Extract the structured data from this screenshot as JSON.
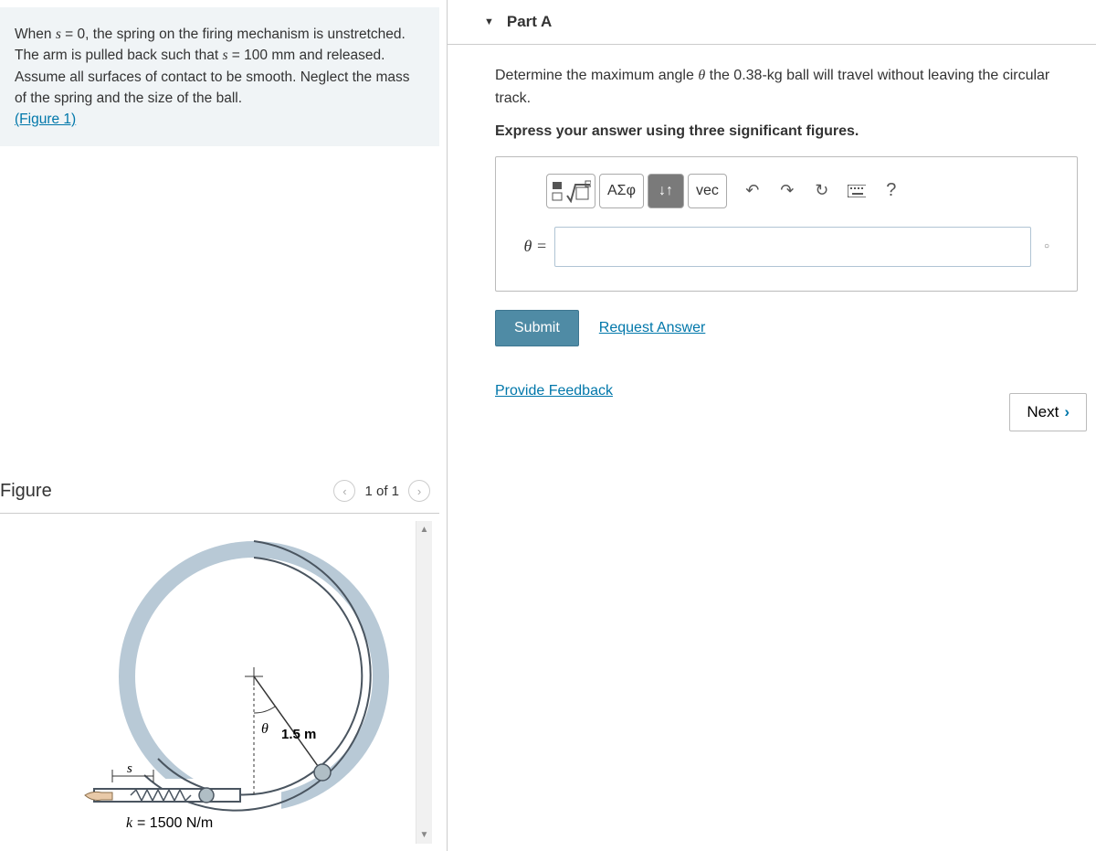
{
  "problem": {
    "text_pre": "When ",
    "var1": "s",
    "text_eq0": " = 0, the spring on the firing mechanism is unstretched. The arm is pulled back such that ",
    "var2": "s",
    "text_eq1": " = 100 ",
    "unit_mm": "mm",
    "text_post": " and released. Assume all surfaces of contact to be smooth. Neglect the mass of the spring and the size of the ball. ",
    "figure_link": "(Figure 1)"
  },
  "figure": {
    "title": "Figure",
    "nav_text": "1 of 1",
    "radius_label": "1.5 m",
    "theta_label": "θ",
    "s_label": "s",
    "k_label": "k = 1500 N/m"
  },
  "part": {
    "title": "Part A",
    "question_pre": "Determine the maximum angle ",
    "theta": "θ",
    "question_mid": " the 0.38-",
    "kg": "kg",
    "question_post": " ball will travel without leaving the circular track.",
    "instruction": "Express your answer using three significant figures.",
    "answer_label": "θ =",
    "tool_greek": "ΑΣφ",
    "tool_vec": "vec",
    "tool_arrows": "↓↑",
    "submit": "Submit",
    "request": "Request Answer",
    "feedback": "Provide Feedback",
    "next": "Next",
    "help": "?"
  },
  "chart_data": {
    "type": "diagram",
    "description": "Ball-spring launcher with circular track",
    "track_radius_m": 1.5,
    "spring_constant_N_per_m": 1500,
    "spring_compression_mm": 100,
    "ball_mass_kg": 0.38,
    "angle_symbol": "θ"
  }
}
